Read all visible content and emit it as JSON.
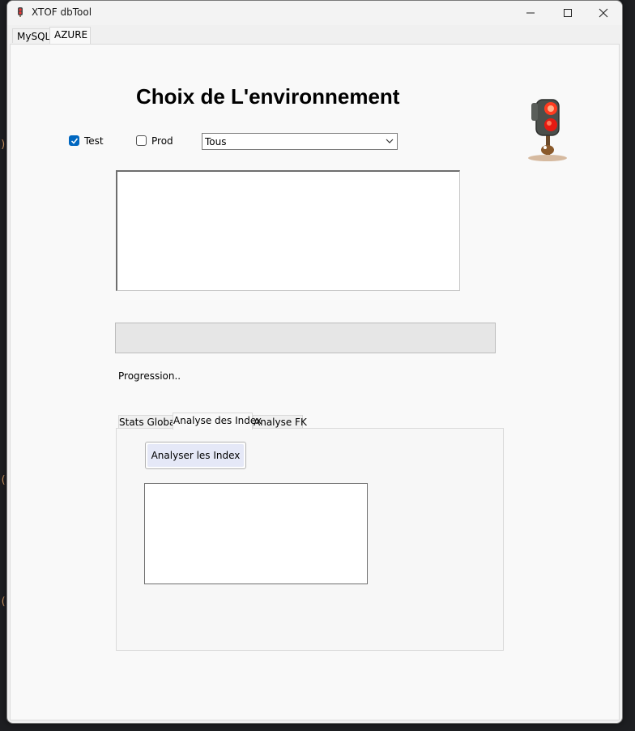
{
  "window": {
    "title": "XTOF dbTool"
  },
  "top_tabs": [
    {
      "label": "MySQL",
      "active": false
    },
    {
      "label": "AZURE",
      "active": true
    }
  ],
  "heading": "Choix de L'environnement",
  "env": {
    "test": {
      "label": "Test",
      "checked": true
    },
    "prod": {
      "label": "Prod",
      "checked": false
    },
    "combo_value": "Tous"
  },
  "status_light": {
    "icon": "traffic-light-icon",
    "state": "red"
  },
  "progress": {
    "label": "Progression..",
    "value": 0
  },
  "inner_tabs": [
    {
      "label": "Stats Global",
      "active": false
    },
    {
      "label": "Analyse des Index",
      "active": true
    },
    {
      "label": "Analyse FK",
      "active": false
    }
  ],
  "analyse_button": "Analyser les Index",
  "colors": {
    "checkbox_accent": "#0067c0",
    "button_bg": "#e5e8f7",
    "window_bg": "#f0f0f0"
  }
}
